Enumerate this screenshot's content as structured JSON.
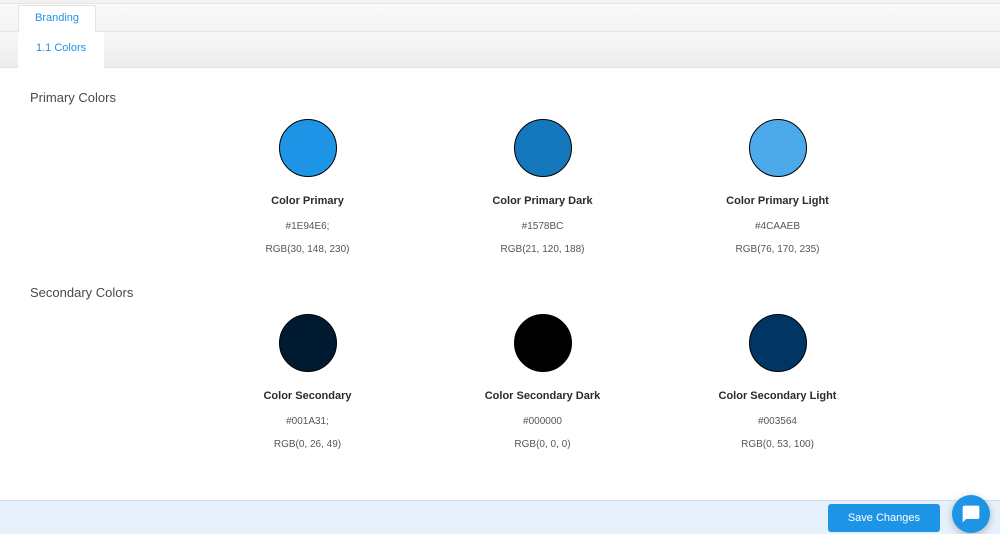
{
  "tabs": {
    "top": "Branding",
    "sub": "1.1 Colors"
  },
  "sections": {
    "primary": {
      "title": "Primary Colors",
      "swatches": [
        {
          "name": "Color Primary",
          "hex": "#1E94E6;",
          "rgb": "RGB(30, 148, 230)",
          "fill": "#1E94E6"
        },
        {
          "name": "Color Primary Dark",
          "hex": "#1578BC",
          "rgb": "RGB(21, 120, 188)",
          "fill": "#1578BC"
        },
        {
          "name": "Color Primary Light",
          "hex": "#4CAAEB",
          "rgb": "RGB(76, 170, 235)",
          "fill": "#4CAAEB"
        }
      ]
    },
    "secondary": {
      "title": "Secondary Colors",
      "swatches": [
        {
          "name": "Color Secondary",
          "hex": "#001A31;",
          "rgb": "RGB(0, 26, 49)",
          "fill": "#001A31"
        },
        {
          "name": "Color Secondary Dark",
          "hex": "#000000",
          "rgb": "RGB(0, 0, 0)",
          "fill": "#000000"
        },
        {
          "name": "Color Secondary Light",
          "hex": "#003564",
          "rgb": "RGB(0, 53, 100)",
          "fill": "#003564"
        }
      ]
    }
  },
  "footer": {
    "save": "Save Changes"
  }
}
